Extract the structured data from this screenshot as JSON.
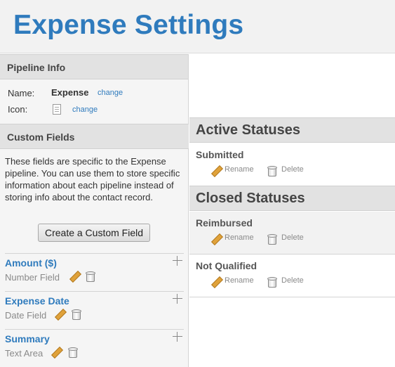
{
  "page_title": "Expense Settings",
  "pipeline_info": {
    "heading": "Pipeline Info",
    "name_label": "Name:",
    "name_value": "Expense",
    "name_change": "change",
    "icon_label": "Icon:",
    "icon_name": "document-icon",
    "icon_change": "change"
  },
  "custom_fields": {
    "heading": "Custom Fields",
    "description": "These fields are specific to the Expense pipeline. You can use them to store specific information about each pipeline instead of storing info about the contact record.",
    "create_label": "Create a Custom Field",
    "fields": [
      {
        "name": "Amount ($)",
        "type": "Number Field"
      },
      {
        "name": "Expense Date",
        "type": "Date Field"
      },
      {
        "name": "Summary",
        "type": "Text Area"
      }
    ]
  },
  "active_statuses": {
    "heading": "Active Statuses",
    "items": [
      {
        "name": "Submitted",
        "rename": "Rename",
        "delete": "Delete"
      }
    ]
  },
  "closed_statuses": {
    "heading": "Closed Statuses",
    "items": [
      {
        "name": "Reimbursed",
        "rename": "Rename",
        "delete": "Delete"
      },
      {
        "name": "Not Qualified",
        "rename": "Rename",
        "delete": "Delete"
      }
    ]
  },
  "icons": {
    "edit": "pencil-icon",
    "delete": "trash-icon",
    "drag": "move-icon"
  },
  "colors": {
    "accent": "#2f7bbd",
    "section_bg": "#e2e2e2"
  }
}
